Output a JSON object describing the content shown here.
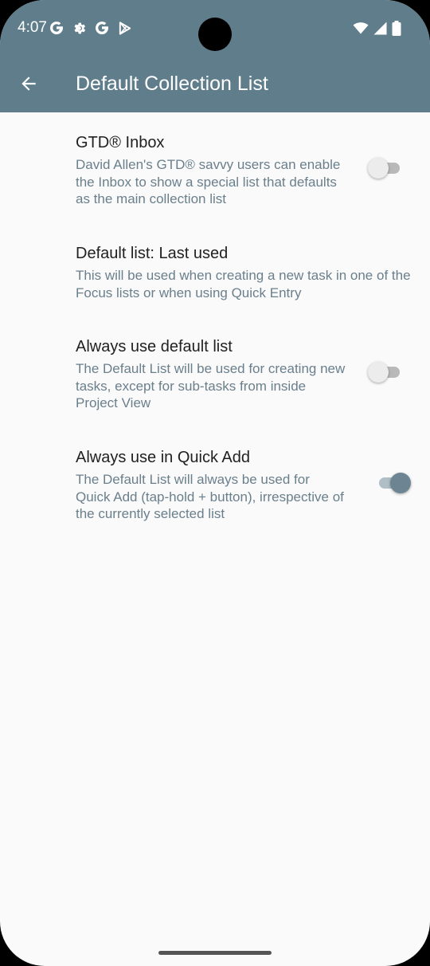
{
  "status_bar": {
    "time": "4:07",
    "left_icons": [
      "google-g-icon",
      "gear-icon",
      "google-g-icon",
      "play-store-icon"
    ],
    "right_icons": [
      "wifi-icon",
      "signal-icon",
      "battery-icon"
    ]
  },
  "app_bar": {
    "title": "Default Collection List",
    "back_icon": "arrow-back-icon",
    "color": "#607d8b"
  },
  "preferences": [
    {
      "title": "GTD® Inbox",
      "summary": "David Allen's GTD® savvy users can enable the Inbox to show a special list that defaults as the main collection list",
      "switch": false
    },
    {
      "title": "Default list: Last used",
      "summary": "This will be used when creating a new task in one of the Focus lists or when using Quick Entry"
    },
    {
      "title": "Always use default list",
      "summary": "The Default List will be used for creating new tasks, except for sub-tasks from inside Project View",
      "switch": false
    },
    {
      "title": "Always use in Quick Add",
      "summary": "The Default List will always be used for Quick Add (tap-hold + button), irrespective of the currently selected list",
      "switch": true
    }
  ],
  "colors": {
    "accent": "#6d8593",
    "summary_text": "#6a7f8c",
    "background": "#fafafa"
  }
}
